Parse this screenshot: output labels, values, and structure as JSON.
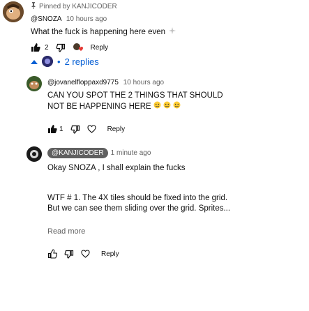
{
  "top_comment": {
    "pinned_label": "Pinned by KANJICODER",
    "author": "@SNOZA",
    "time": "10 hours ago",
    "text": "What the fuck is happening here even",
    "like_count": "2",
    "reply_label": "Reply"
  },
  "replies_toggle": {
    "label": "2 replies"
  },
  "reply1": {
    "author": "@jovanelfloppaxd9775",
    "time": "10 hours ago",
    "text_line1": "CAN YOU SPOT THE 2 THINGS THAT SHOULD",
    "text_line2": "NOT BE HAPPENING HERE",
    "like_count": "1",
    "reply_label": "Reply"
  },
  "reply2": {
    "author_badge": "@KANJICODER",
    "time": "1 minute ago",
    "text_line1": "Okay SNOZA , I shall explain the fucks",
    "text_line2": "WTF # 1. The 4X tiles should be fixed into the grid.",
    "text_line3": "But we can see them sliding over the grid. Sprites...",
    "read_more": "Read more",
    "reply_label": "Reply"
  },
  "colors": {
    "link_blue": "#065fd4",
    "meta_gray": "#606060",
    "badge_gray": "#606060"
  }
}
